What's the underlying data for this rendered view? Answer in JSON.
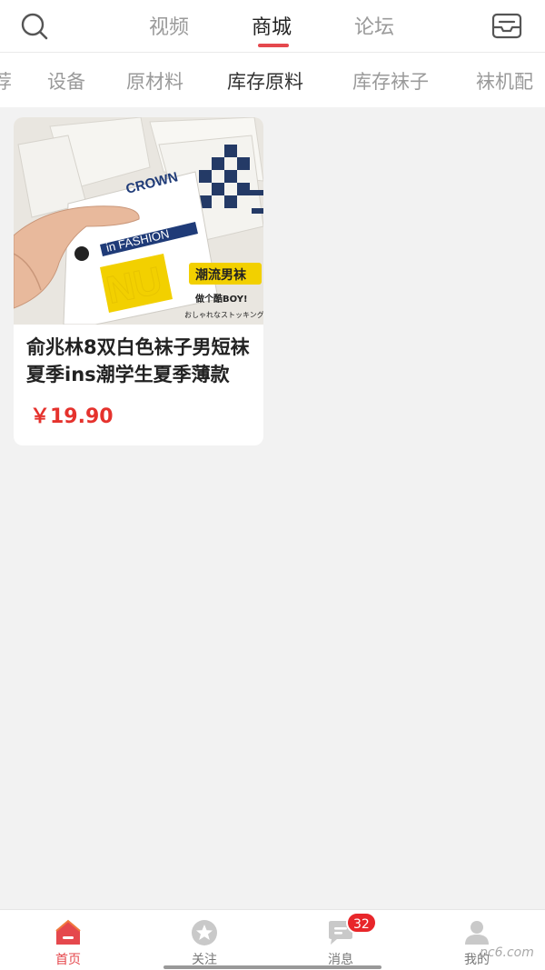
{
  "header": {
    "tabs": [
      {
        "label": "视频"
      },
      {
        "label": "商城"
      },
      {
        "label": "论坛"
      }
    ],
    "active_tab": "商城",
    "icons": {
      "search": "search-icon",
      "mail": "mail-icon"
    }
  },
  "categories": {
    "items": [
      {
        "label": "荐"
      },
      {
        "label": "设备"
      },
      {
        "label": "原材料"
      },
      {
        "label": "库存原料"
      },
      {
        "label": "库存袜子"
      },
      {
        "label": "袜机配"
      }
    ],
    "active": "库存原料"
  },
  "product": {
    "title": "俞兆林8双白色袜子男短袜夏季ins潮学生夏季薄款",
    "price": "￥19.90",
    "image_text": {
      "brand1": "CROWN",
      "brand2": "in FASHION",
      "big": "NU",
      "tag": "潮流男袜",
      "sub1": "做个酷BOY!",
      "sub2": "おしゃれなストッキング"
    }
  },
  "tabbar": {
    "items": [
      {
        "label": "首页",
        "icon": "home-icon"
      },
      {
        "label": "关注",
        "icon": "star-icon"
      },
      {
        "label": "消息",
        "icon": "message-icon"
      },
      {
        "label": "我的",
        "icon": "user-icon"
      }
    ],
    "active": "首页",
    "message_badge": "32"
  },
  "watermark": "pc6.com",
  "colors": {
    "accent": "#e5484d",
    "price": "#e5322d",
    "badge": "#e8262a"
  }
}
